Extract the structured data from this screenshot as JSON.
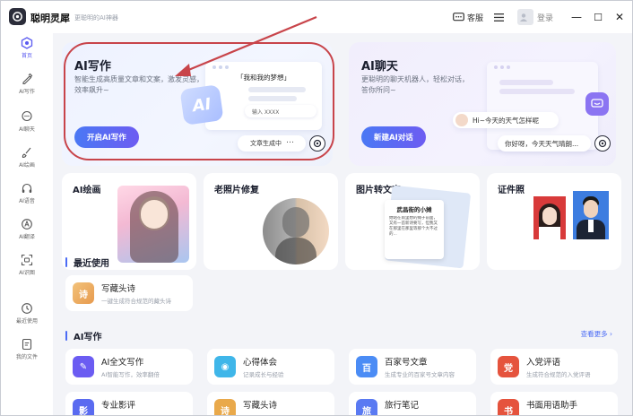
{
  "app": {
    "name": "聪明灵犀",
    "slogan": "更聪明的AI神器"
  },
  "titlebar": {
    "service_label": "客服",
    "login_label": "登录",
    "minimize": "—",
    "maximize": "☐",
    "close": "✕"
  },
  "sidebar": {
    "items": [
      {
        "label": "首页",
        "icon": "home-icon",
        "active": true
      },
      {
        "label": "AI写作",
        "icon": "pen-icon"
      },
      {
        "label": "AI聊天",
        "icon": "chat-icon"
      },
      {
        "label": "AI绘画",
        "icon": "brush-icon"
      },
      {
        "label": "AI语音",
        "icon": "headphones-icon"
      },
      {
        "label": "AI翻译",
        "icon": "translate-icon"
      },
      {
        "label": "AI识图",
        "icon": "scan-icon"
      },
      {
        "label": "最近使用",
        "icon": "clock-icon"
      },
      {
        "label": "我的文件",
        "icon": "file-icon"
      }
    ]
  },
  "hero_write": {
    "title": "AI写作",
    "desc": "智能生成高质量文章和文案，激发灵感，效率飙升~",
    "button": "开启AI写作",
    "mock_title": "「我和我的梦想」",
    "mock_progress": "文章生成中",
    "mock_ai": "AI",
    "mock_hint": "输入 XXXX"
  },
  "hero_chat": {
    "title": "AI聊天",
    "desc": "更聪明的聊天机器人，轻松对话，答你所问~",
    "button": "新建AI对话",
    "bubble_user": "Hi~今天的天气怎样呢",
    "bubble_bot": "你好呀，今天天气晴朗..."
  },
  "features": [
    {
      "title": "AI绘画"
    },
    {
      "title": "老照片修复"
    },
    {
      "title": "图片转文字",
      "doc_title": "武昌街的小摊",
      "doc_text": "她站在雨里想的摊子前面，又有一首新诗要写，但我又在那里在那里等那个大不过的..."
    },
    {
      "title": "证件照"
    }
  ],
  "recent": {
    "title": "最近使用",
    "items": [
      {
        "name": "写藏头诗",
        "desc": "一键生成符合规范的藏头诗",
        "icon_char": "诗"
      }
    ]
  },
  "ai_writing": {
    "title": "AI写作",
    "more": "查看更多 ›",
    "tools": [
      {
        "name": "AI全文写作",
        "desc": "AI智能写作，效率翻倍",
        "icon_char": "✎",
        "color": "#6b5cf2"
      },
      {
        "name": "心得体会",
        "desc": "记录成长与经验",
        "icon_char": "◉",
        "color": "#3fb6e9"
      },
      {
        "name": "百家号文章",
        "desc": "生成专业的百家号文章内容",
        "icon_char": "百",
        "color": "#4b8cf5"
      },
      {
        "name": "入党评语",
        "desc": "生成符合规范的入党评语",
        "icon_char": "党",
        "color": "#e5533d"
      },
      {
        "name": "专业影评",
        "desc": "",
        "icon_char": "影",
        "color": "#5a6bf0"
      },
      {
        "name": "写藏头诗",
        "desc": "",
        "icon_char": "诗",
        "color": "#e9a94b"
      },
      {
        "name": "旅行笔记",
        "desc": "",
        "icon_char": "旅",
        "color": "#5a7af2"
      },
      {
        "name": "书面用语助手",
        "desc": "",
        "icon_char": "书",
        "color": "#e5533d"
      }
    ]
  }
}
